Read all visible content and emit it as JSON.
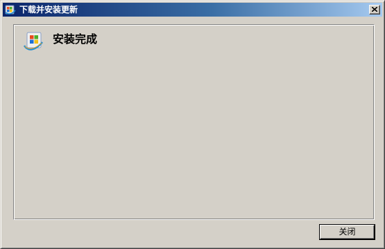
{
  "window": {
    "title": "下载并安装更新",
    "title_icon": "windows-update-icon",
    "close_glyph": "×"
  },
  "panel": {
    "icon": "windows-update-icon",
    "status_text": "安装完成"
  },
  "buttons": {
    "close_label": "关闭"
  },
  "colors": {
    "titlebar_start": "#0a246a",
    "titlebar_end": "#a6caf0",
    "face": "#d4d0c8"
  }
}
